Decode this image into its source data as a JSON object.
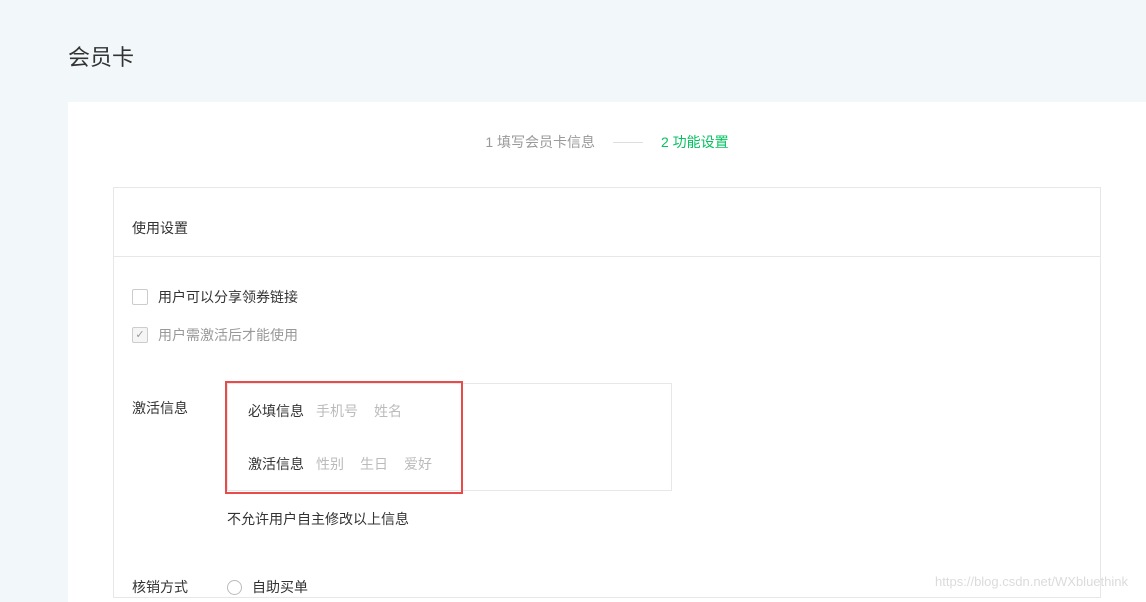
{
  "page": {
    "title": "会员卡"
  },
  "steps": {
    "step1": "1 填写会员卡信息",
    "step2": "2 功能设置"
  },
  "section": {
    "usage_settings": "使用设置"
  },
  "checkboxes": {
    "share_link": "用户可以分享领券链接",
    "require_activation": "用户需激活后才能使用"
  },
  "activation": {
    "label": "激活信息",
    "required_label": "必填信息",
    "required_tags": [
      "手机号",
      "姓名"
    ],
    "activation_label": "激活信息",
    "activation_tags": [
      "性别",
      "生日",
      "爱好"
    ],
    "hint": "不允许用户自主修改以上信息"
  },
  "verification": {
    "label": "核销方式",
    "option1": "自助买单"
  },
  "watermark": "https://blog.csdn.net/WXbluethink"
}
